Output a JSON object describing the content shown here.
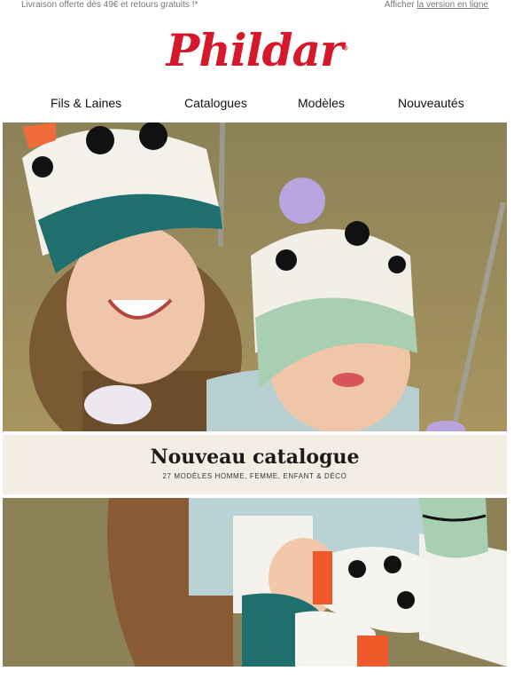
{
  "topbar": {
    "shipping_notice": "Livraison offerte dès 49€ et retours gratuits !*",
    "view_online_prefix": "Afficher",
    "view_online_link": "la version en ligne"
  },
  "brand": {
    "logo_text": "Phildar",
    "registered": "®",
    "color": "#d6192a"
  },
  "nav": {
    "items": [
      "Fils & Laines",
      "Catalogues",
      "Modèles",
      "Nouveautés"
    ]
  },
  "banner": {
    "title": "Nouveau catalogue",
    "subtitle": "27 MODÈLES HOMME, FEMME, ENFANT & DÉCO"
  }
}
